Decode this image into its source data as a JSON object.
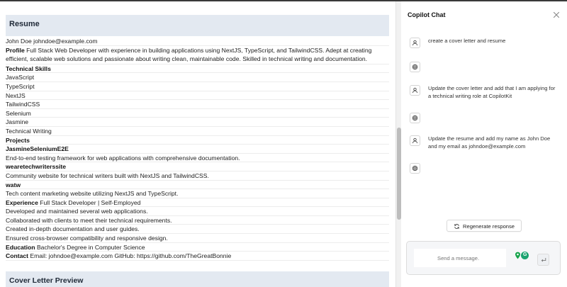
{
  "resume": {
    "section_title": "Resume",
    "name_email": "John Doe johndoe@example.com",
    "profile_label": "Profile",
    "profile_text": "Full Stack Web Developer with experience in building applications using NextJS, TypeScript, and TailwindCSS. Adept at creating efficient, scalable web solutions and passionate about writing clean, maintainable code. Skilled in technical writing and documentation.",
    "skills_label": "Technical Skills",
    "skills": [
      "JavaScript",
      "TypeScript",
      "NextJS",
      "TailwindCSS",
      "Selenium",
      "Jasmine",
      "Technical Writing"
    ],
    "projects_label": "Projects",
    "projects": [
      {
        "name": "JasmineSeleniumE2E",
        "description": "End-to-end testing framework for web applications with comprehensive documentation."
      },
      {
        "name": "wearetechwriterssite",
        "description": "Community website for technical writers built with NextJS and TailwindCSS."
      },
      {
        "name": "watw",
        "description": "Tech content marketing website utilizing NextJS and TypeScript."
      }
    ],
    "experience_label": "Experience",
    "experience_role": "Full Stack Developer | Self-Employed",
    "experience_items": [
      "Developed and maintained several web applications.",
      "Collaborated with clients to meet their technical requirements.",
      "Created in-depth documentation and user guides.",
      "Ensured cross-browser compatibility and responsive design."
    ],
    "education_label": "Education",
    "education_text": "Bachelor's Degree in Computer Science",
    "contact_label": "Contact",
    "contact_text": "Email: johndoe@example.com GitHub: https://github.com/TheGreatBonnie"
  },
  "cover_letter": {
    "section_title": "Cover Letter Preview"
  },
  "chat": {
    "title": "Copilot Chat",
    "messages": [
      {
        "role": "user",
        "text": "create a cover letter and resume"
      },
      {
        "role": "assistant",
        "text": ""
      },
      {
        "role": "user",
        "text": "Update the cover letter and add that I am applying for a technical writing role at CopilotKit"
      },
      {
        "role": "assistant",
        "text": ""
      },
      {
        "role": "user",
        "text": "Update the resume and add my name as John Doe and my email as johndoe@example.com"
      },
      {
        "role": "assistant",
        "text": ""
      }
    ],
    "regenerate_label": "Regenerate response",
    "input_placeholder": "Send a message.",
    "input_value": "",
    "icons": {
      "close": "close-icon",
      "user": "user-icon",
      "assistant": "openai-icon",
      "regenerate": "refresh-icon",
      "send": "return-icon",
      "extension_1": "map-pin-icon",
      "extension_2": "grammarly-icon"
    },
    "extension_2_letter": "G"
  },
  "colors": {
    "header_bg": "#e3e9f1",
    "grammarly_green": "#1aa36f",
    "pin_green": "#16a34a"
  }
}
